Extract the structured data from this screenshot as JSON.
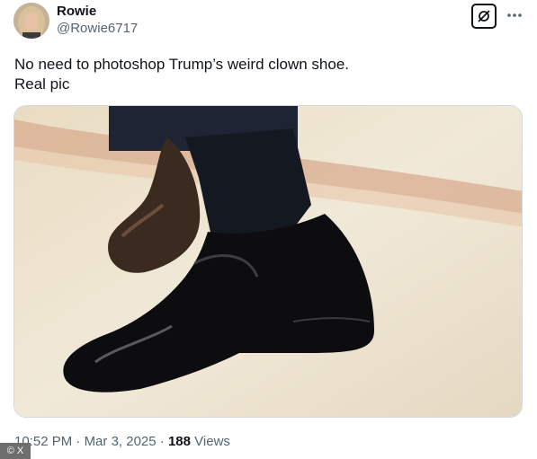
{
  "author": {
    "display_name": "Rowie",
    "handle": "@Rowie6717"
  },
  "tweet": {
    "text_lines": [
      "No need to photoshop Trump’s weird clown shoe.",
      "Real pic"
    ]
  },
  "meta": {
    "time": "10:52 PM",
    "separator": "·",
    "date": "Mar 3, 2025",
    "views_count": "188",
    "views_label": "Views"
  },
  "watermark": {
    "text": "© X"
  },
  "icons": {
    "grok": "grok-icon",
    "more": "more-dots-icon"
  },
  "colors": {
    "text": "#0f1419",
    "secondary_text": "#536471",
    "border": "#cfd9de"
  }
}
